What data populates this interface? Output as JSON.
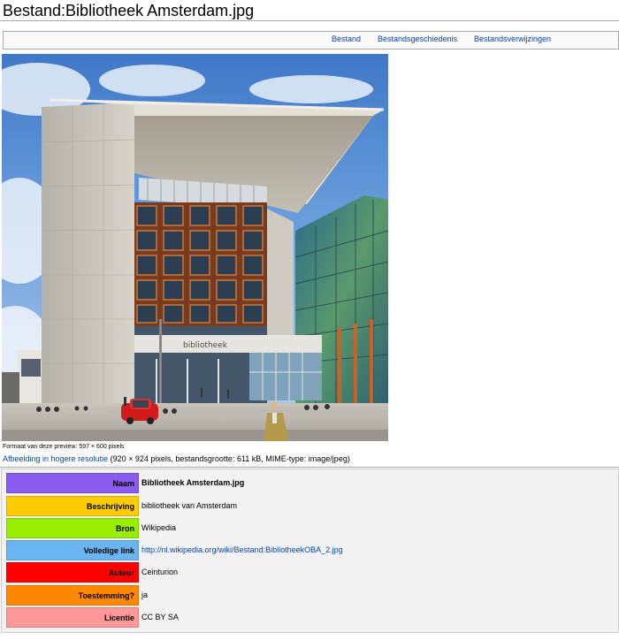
{
  "page": {
    "title": "Bestand:Bibliotheek Amsterdam.jpg"
  },
  "tabs": [
    {
      "label": "Bestand"
    },
    {
      "label": "Bestandsgeschiedenis"
    },
    {
      "label": "Bestandsverwijzingen"
    }
  ],
  "image": {
    "preview_note": "Formaat van deze preview: 597 × 600 pixels",
    "hires_link": "Afbeelding in hogere resolutie",
    "hires_details": " (920 × 924 pixels, bestandsgrootte: 611 kB, MIME-type: image/jpeg)",
    "sign_text": "bibliotheek"
  },
  "info": {
    "rows": [
      {
        "key": "Naam",
        "value": "Bibliotheek Amsterdam.jpg",
        "color": "#8a5cf0"
      },
      {
        "key": "Beschrijving",
        "value": "bibliotheek van Amsterdam",
        "color": "#ffcc00"
      },
      {
        "key": "Bron",
        "value": "Wikipedia",
        "color": "#99ee00"
      },
      {
        "key": "Volledige link",
        "value": "http://nl.wikipedia.org/wiki/Bestand:BibliotheekOBA_2.jpg",
        "color": "#6ab4f0"
      },
      {
        "key": "Auteur",
        "value": "Ceinturion",
        "color": "#ff0000"
      },
      {
        "key": "Toestemming?",
        "value": "ja",
        "color": "#ff8800"
      },
      {
        "key": "Licentie",
        "value": "CC BY SA",
        "color": "#ff9999"
      }
    ]
  }
}
